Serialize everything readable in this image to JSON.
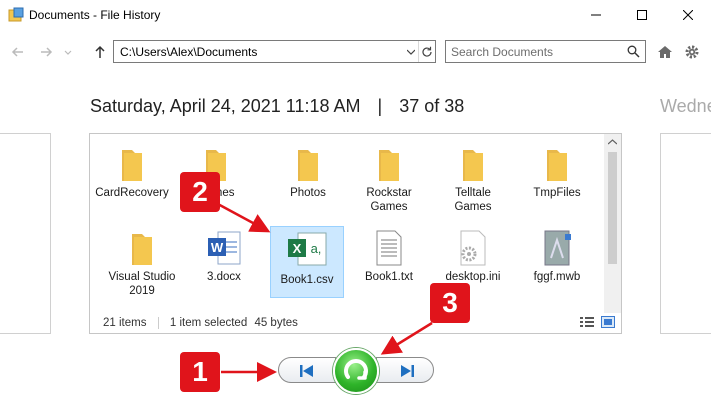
{
  "window": {
    "title": "Documents - File History"
  },
  "nav": {
    "address": "C:\\Users\\Alex\\Documents",
    "search_placeholder": "Search Documents"
  },
  "header": {
    "date": "Saturday, April 24, 2021 11:18 AM",
    "separator": "|",
    "position": "37 of 38",
    "next_date_partial": "Wedne"
  },
  "files": [
    {
      "label": "CardRecovery",
      "type": "folder"
    },
    {
      "label": "Games",
      "type": "folder"
    },
    {
      "label": "Photos",
      "type": "folder"
    },
    {
      "label": "Rockstar Games",
      "type": "folder"
    },
    {
      "label": "Telltale Games",
      "type": "folder"
    },
    {
      "label": "TmpFiles",
      "type": "folder"
    },
    {
      "label": "Visual Studio 2019",
      "type": "folder"
    },
    {
      "label": "3.docx",
      "type": "word"
    },
    {
      "label": "Book1.csv",
      "type": "excel",
      "selected": true
    },
    {
      "label": "Book1.txt",
      "type": "text"
    },
    {
      "label": "desktop.ini",
      "type": "ini"
    },
    {
      "label": "fggf.mwb",
      "type": "mwb"
    }
  ],
  "status": {
    "items": "21 items",
    "selected": "1 item selected",
    "size": "45 bytes"
  },
  "annotations": {
    "one": "1",
    "two": "2",
    "three": "3"
  },
  "colors": {
    "selection": "#cce8ff",
    "folder": "#f4c74f",
    "badge": "#e0141b",
    "restore": "#2fb42a",
    "nav_blue": "#1f6fc0"
  }
}
